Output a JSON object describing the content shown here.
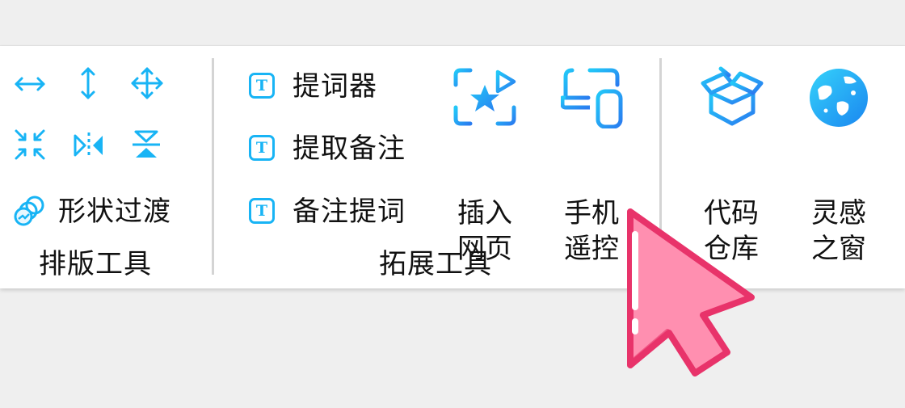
{
  "layout_tools": {
    "group_title": "排版工具",
    "icons": [
      "horizontal-distribute-icon",
      "vertical-distribute-icon",
      "move-arrows-icon",
      "shrink-arrows-icon",
      "flip-horizontal-icon",
      "flip-vertical-icon"
    ],
    "shape_transition_label": "形状过渡"
  },
  "extension_tools": {
    "group_title": "拓展工具",
    "items": [
      {
        "icon_text": "T",
        "label": "提词器"
      },
      {
        "icon_text": "T",
        "label": "提取备注"
      },
      {
        "icon_text": "T",
        "label": "备注提词"
      }
    ],
    "insert_webpage": {
      "line1": "插入",
      "line2": "网页"
    },
    "phone_remote": {
      "line1": "手机",
      "line2": "遥控"
    }
  },
  "resources": {
    "code_repo": {
      "line1": "代码",
      "line2": "仓库"
    },
    "inspiration_window": {
      "line1": "灵感",
      "line2": "之窗"
    }
  },
  "colors": {
    "accent": "#18b4f5",
    "accent_gradient_end": "#2a7cf0",
    "cursor_fill": "#ff8fb0",
    "cursor_stroke": "#e8336a"
  }
}
